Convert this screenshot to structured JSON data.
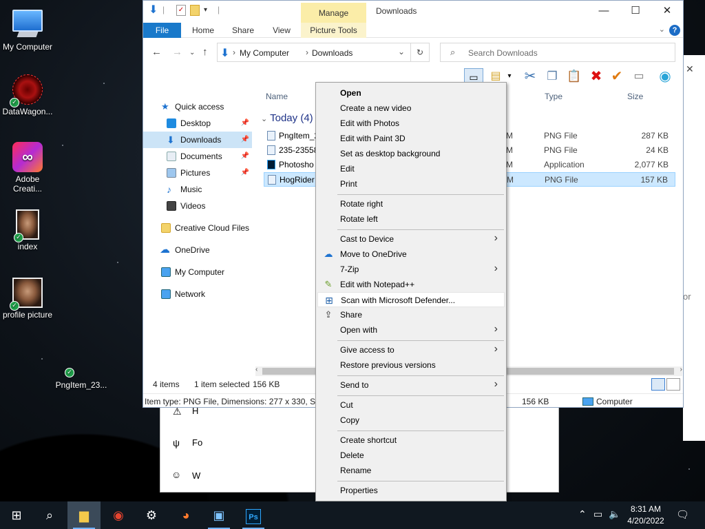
{
  "desktop": {
    "icons": [
      {
        "label": "My Computer"
      },
      {
        "label": "DataWagon..."
      },
      {
        "label": "Adobe Creati..."
      },
      {
        "label": "index"
      },
      {
        "label": "profile picture"
      },
      {
        "label": "PngItem_23..."
      }
    ]
  },
  "window": {
    "title": "Downloads",
    "manage_tab": "Manage",
    "ribbon_tabs": [
      "File",
      "Home",
      "Share",
      "View",
      "Picture Tools"
    ],
    "breadcrumb": [
      "My Computer",
      "Downloads"
    ],
    "search_placeholder": "Search Downloads",
    "buttons": {
      "minimize": "—",
      "maximize": "☐",
      "close": "✕",
      "help": "?"
    }
  },
  "navpane": {
    "items": [
      {
        "label": "Quick access"
      },
      {
        "label": "Desktop"
      },
      {
        "label": "Downloads"
      },
      {
        "label": "Documents"
      },
      {
        "label": "Pictures"
      },
      {
        "label": "Music"
      },
      {
        "label": "Videos"
      },
      {
        "label": "Creative Cloud Files"
      },
      {
        "label": "OneDrive"
      },
      {
        "label": "My Computer"
      },
      {
        "label": "Network"
      }
    ]
  },
  "filelist": {
    "columns": {
      "name": "Name",
      "type": "Type",
      "size": "Size"
    },
    "group": "Today (4)",
    "rows": [
      {
        "name": "PngItem_2",
        "dm": "M",
        "type": "PNG File",
        "size": "287 KB"
      },
      {
        "name": "235-23558",
        "dm": "M",
        "type": "PNG File",
        "size": "24 KB"
      },
      {
        "name": "Photosho",
        "dm": "M",
        "type": "Application",
        "size": "2,077 KB"
      },
      {
        "name": "HogRider",
        "dm": "M",
        "type": "PNG File",
        "size": "157 KB"
      }
    ]
  },
  "status": {
    "items": "4 items",
    "selected": "1 item selected",
    "selected_size": "156 KB",
    "details": "Item type: PNG File, Dimensions: 277 x 330, Size",
    "details_size": "156 KB",
    "details_location": "Computer"
  },
  "context_menu": {
    "items": [
      {
        "label": "Open"
      },
      {
        "label": "Create a new video"
      },
      {
        "label": "Edit with Photos"
      },
      {
        "label": "Edit with Paint 3D"
      },
      {
        "label": "Set as desktop background"
      },
      {
        "label": "Edit"
      },
      {
        "label": "Print"
      },
      {
        "label": "Rotate right"
      },
      {
        "label": "Rotate left"
      },
      {
        "label": "Cast to Device"
      },
      {
        "label": "Move to OneDrive"
      },
      {
        "label": "7-Zip"
      },
      {
        "label": "Edit with Notepad++"
      },
      {
        "label": "Scan with Microsoft Defender..."
      },
      {
        "label": "Share"
      },
      {
        "label": "Open with"
      },
      {
        "label": "Give access to"
      },
      {
        "label": "Restore previous versions"
      },
      {
        "label": "Send to"
      },
      {
        "label": "Cut"
      },
      {
        "label": "Copy"
      },
      {
        "label": "Create shortcut"
      },
      {
        "label": "Delete"
      },
      {
        "label": "Rename"
      },
      {
        "label": "Properties"
      }
    ]
  },
  "taskbar": {
    "time": "8:31 AM",
    "date": "4/20/2022"
  },
  "behind": {
    "right_fragment": "or",
    "letters": [
      "H",
      "Fo",
      "W"
    ]
  },
  "colors": {
    "accent": "#1979ca",
    "selection": "#cce8ff",
    "manage_tab": "#fbeda8",
    "taskbar": "#101820"
  }
}
